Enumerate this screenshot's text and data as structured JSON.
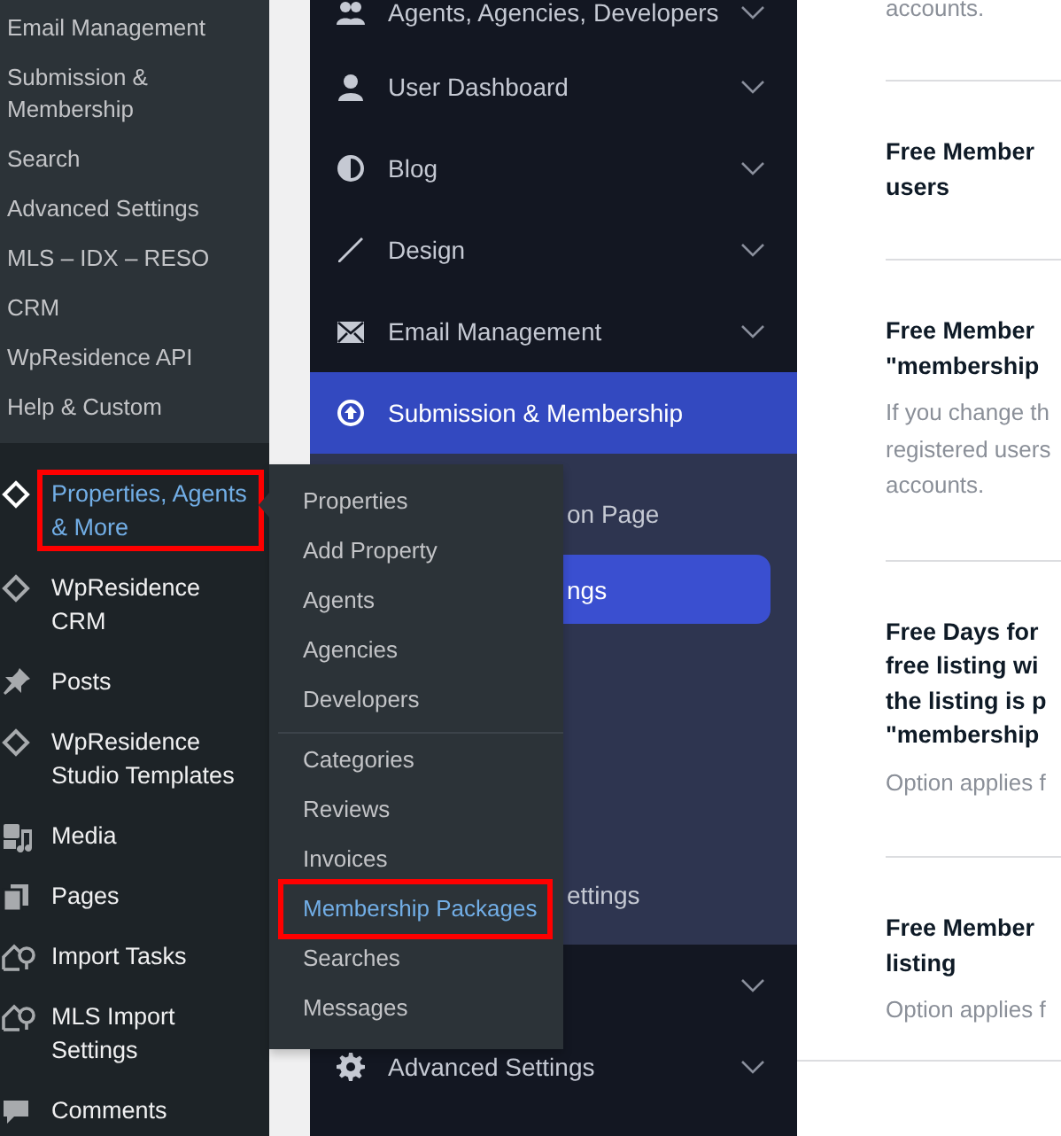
{
  "admin_menu": {
    "submenu_items": [
      "Email Management",
      "Submission & Membership",
      "Search",
      "Advanced Settings",
      "MLS – IDX – RESO",
      "CRM",
      "WpResidence API",
      "Help & Custom"
    ],
    "items": [
      {
        "label": "Properties, Agents & More",
        "selected": true,
        "annotated": true
      },
      {
        "label": "WpResidence CRM",
        "selected": false,
        "annotated": false
      },
      {
        "label": "Posts",
        "selected": false,
        "annotated": false
      },
      {
        "label": "WpResidence Studio Templates",
        "selected": false,
        "annotated": false
      },
      {
        "label": "Media",
        "selected": false,
        "annotated": false
      },
      {
        "label": "Pages",
        "selected": false,
        "annotated": false
      },
      {
        "label": "Import Tasks",
        "selected": false,
        "annotated": false
      },
      {
        "label": "MLS Import Settings",
        "selected": false,
        "annotated": false
      },
      {
        "label": "Comments",
        "selected": false,
        "annotated": false
      }
    ]
  },
  "flyout": {
    "groups": [
      [
        {
          "label": "Properties",
          "selected": false,
          "annotated": false
        },
        {
          "label": "Add Property",
          "selected": false,
          "annotated": false
        },
        {
          "label": "Agents",
          "selected": false,
          "annotated": false
        },
        {
          "label": "Agencies",
          "selected": false,
          "annotated": false
        },
        {
          "label": "Developers",
          "selected": false,
          "annotated": false
        }
      ],
      [
        {
          "label": "Categories",
          "selected": false,
          "annotated": false
        },
        {
          "label": "Reviews",
          "selected": false,
          "annotated": false
        },
        {
          "label": "Invoices",
          "selected": false,
          "annotated": false
        },
        {
          "label": "Membership Packages",
          "selected": true,
          "annotated": true
        },
        {
          "label": "Searches",
          "selected": false,
          "annotated": false
        },
        {
          "label": "Messages",
          "selected": false,
          "annotated": false
        }
      ]
    ]
  },
  "options_nav": {
    "items": [
      {
        "label": "Agents, Agencies, Developers",
        "selected": false
      },
      {
        "label": "User Dashboard",
        "selected": false
      },
      {
        "label": "Blog",
        "selected": false
      },
      {
        "label": "Design",
        "selected": false
      },
      {
        "label": "Email Management",
        "selected": false
      },
      {
        "label": "Submission & Membership",
        "selected": true,
        "children": [
          {
            "label": "on Page",
            "selected": false
          },
          {
            "label": "ngs",
            "selected": true
          },
          {
            "label": "ettings",
            "selected": false
          }
        ]
      },
      {
        "selected": false
      },
      {
        "label": "Advanced Settings",
        "selected": false
      }
    ]
  },
  "content": {
    "top_text": "accounts.",
    "sections": [
      {
        "title": "Free Member\nusers"
      },
      {
        "title": "Free Member\n\"membership",
        "description": "If you change th\nregistered users\naccounts."
      },
      {
        "title": "Free Days for\nfree listing wi\nthe listing is p\n\"membership",
        "description": "Option applies f"
      },
      {
        "title": "Free Member\nlisting",
        "description": "Option applies f"
      }
    ]
  }
}
